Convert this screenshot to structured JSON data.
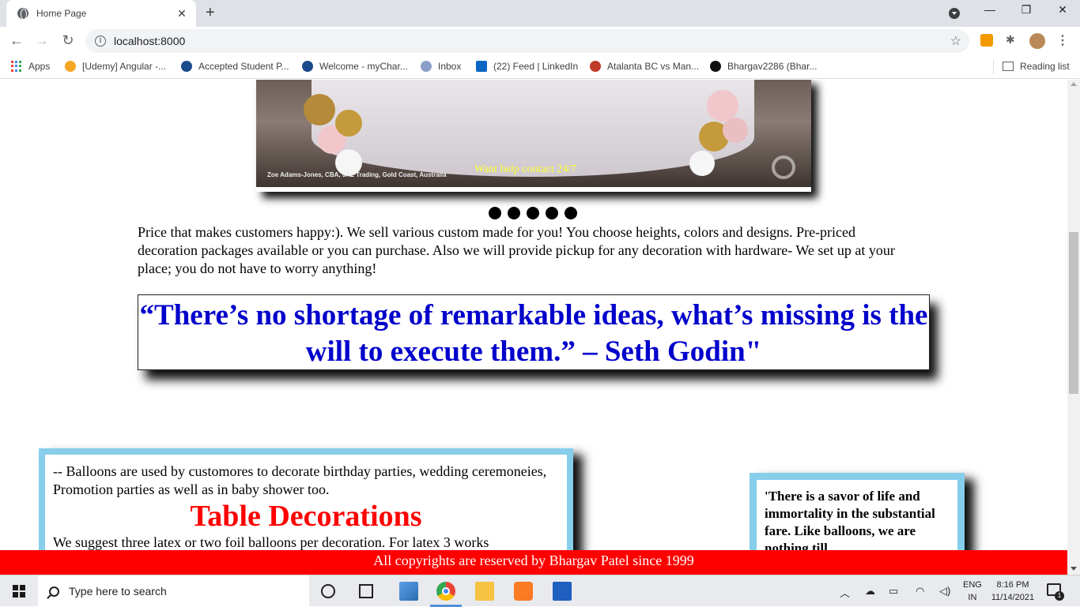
{
  "browser": {
    "tab_title": "Home Page",
    "tab_close": "✕",
    "new_tab": "+",
    "url": "localhost:8000",
    "window_controls": {
      "minimize": "—",
      "maximize": "❐",
      "close": "✕"
    }
  },
  "bookmarks": {
    "items": [
      {
        "label": "Apps",
        "icon": "apps-grid-icon"
      },
      {
        "label": "[Udemy] Angular -...",
        "icon": "udemy-icon",
        "color": "#f5a623"
      },
      {
        "label": "Accepted Student P...",
        "icon": "university-icon",
        "color": "#1a4a8a"
      },
      {
        "label": "Welcome - myChar...",
        "icon": "university-icon",
        "color": "#1a4a8a"
      },
      {
        "label": "Inbox",
        "icon": "mail-icon",
        "color": "#8aa0c8"
      },
      {
        "label": "(22) Feed | LinkedIn",
        "icon": "linkedin-icon",
        "color": "#0a66c2"
      },
      {
        "label": "Atalanta BC vs Man...",
        "icon": "soccer-icon",
        "color": "#c0392b"
      },
      {
        "label": "Bhargav2286 (Bhar...",
        "icon": "github-icon",
        "color": "#111111"
      }
    ],
    "reading_list": "Reading list"
  },
  "page": {
    "slide_credit": "Zoe Adams-Jones, CBA, JAZ Trading, Gold Coast, Australia",
    "slide_caption": "Want help contact 24/7",
    "slide_dots": 5,
    "intro": "Price that makes customers happy:). We sell various custom made for you! You choose heights, colors and designs. Pre-priced decoration packages available or you can purchase. Also we will provide pickup for any decoration with hardware- We set up at your place; you do not have to worry anything!",
    "quote": "“There’s no shortage of remarkable ideas, what’s missing is the will to execute them.” – Seth Godin\"",
    "left_card": {
      "text": "-- Balloons are used by customores to decorate birthday parties, wedding ceremoneies, Promotion parties as well as in baby shower too.",
      "heading": "Table Decorations",
      "more": "We suggest three latex or two foil balloons per decoration. For latex 3 works"
    },
    "right_card": {
      "text": "'There is a savor of life and immortality in the substantial fare. Like balloons, we are nothing till"
    },
    "footer": "All copyrights are reserved by Bhargav Patel since 1999"
  },
  "taskbar": {
    "search_placeholder": "Type here to search",
    "lang_top": "ENG",
    "lang_bottom": "IN",
    "time": "8:16 PM",
    "date": "11/14/2021",
    "notification_count": "1"
  },
  "colors": {
    "quote": "#0000cc",
    "heading": "#ff0000",
    "footer": "#ff0000",
    "card_border": "#87ceeb",
    "caption": "#ffff33"
  }
}
